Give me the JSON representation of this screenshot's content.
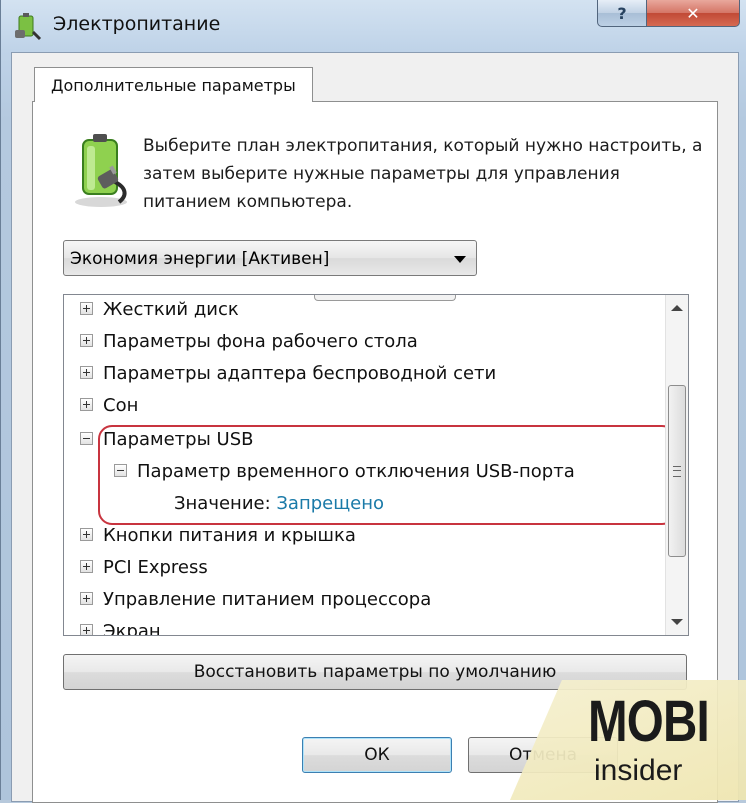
{
  "window": {
    "title": "Электропитание",
    "help_label": "?",
    "close_label": "✕"
  },
  "tab": {
    "label": "Дополнительные параметры"
  },
  "description": "Выберите план электропитания, который нужно настроить, а затем выберите нужные параметры для управления питанием компьютера.",
  "plan_select": {
    "value": "Экономия энергии [Активен]"
  },
  "tree": {
    "items": [
      {
        "label": "Жесткий диск",
        "expanded": false
      },
      {
        "label": "Параметры фона рабочего стола",
        "expanded": false
      },
      {
        "label": "Параметры адаптера беспроводной сети",
        "expanded": false
      },
      {
        "label": "Сон",
        "expanded": false
      },
      {
        "label": "Параметры USB",
        "expanded": true
      },
      {
        "label": "Параметр временного отключения USB-порта",
        "expanded": true
      },
      {
        "label": "Значение:",
        "value": "Запрещено"
      },
      {
        "label": "Кнопки питания и крышка",
        "expanded": false
      },
      {
        "label": "PCI Express",
        "expanded": false
      },
      {
        "label": "Управление питанием процессора",
        "expanded": false
      },
      {
        "label": "Экран",
        "expanded": false
      }
    ]
  },
  "buttons": {
    "restore_label": "Восстановить параметры по умолчанию",
    "ok_label": "ОК",
    "cancel_label": "Отмена"
  },
  "watermark": {
    "line1": "MOBI",
    "line2": "insider"
  },
  "colors": {
    "highlight": "#c8343f",
    "value_link": "#1a7aa8"
  }
}
